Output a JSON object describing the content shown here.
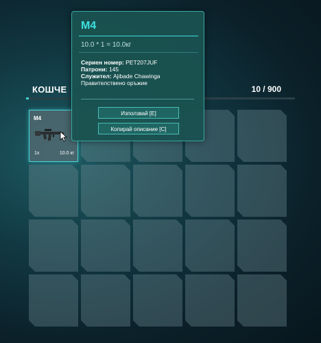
{
  "inventory": {
    "title": "КОШЧЕ",
    "count": "10 / 900",
    "fill_fraction": 0.011,
    "slots_total": 20
  },
  "item": {
    "name": "M4",
    "qty": "1x",
    "weight": "10.0 кг",
    "icon": "rifle-icon"
  },
  "tooltip": {
    "title": "M4",
    "formula": "10.0 * 1 = 10.0кг",
    "serial_label": "Сериен номер:",
    "serial_value": "PET207JUF",
    "ammo_label": "Патрони:",
    "ammo_value": "145",
    "employee_label": "Служител:",
    "employee_value": "Ajibade Chawinga",
    "description": "Правителствено оръжие",
    "use_button": "Използвай [E]",
    "copy_button": "Копирай описание [C]"
  },
  "colors": {
    "accent": "#3de0e0",
    "slot_border": "#45d6d6"
  }
}
